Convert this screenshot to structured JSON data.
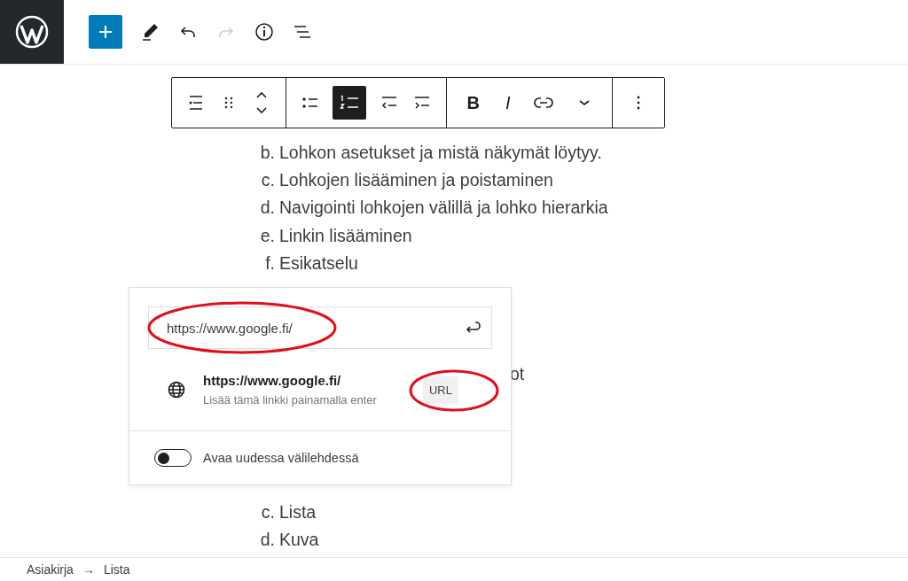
{
  "top_toolbar": {
    "add_block_selected": true,
    "redo_disabled": true
  },
  "block_toolbar": {
    "bulleted_selected": false,
    "numbered_selected": true,
    "bold": "B",
    "italic": "I"
  },
  "list_top": [
    {
      "marker": "b.",
      "text": "Lohkon asetukset ja mistä näkymät löytyy."
    },
    {
      "marker": "c.",
      "text": "Lohkojen lisääminen ja poistaminen"
    },
    {
      "marker": "d.",
      "text": "Navigointi lohkojen välillä ja lohko hierarkia"
    },
    {
      "marker": "e.",
      "text": "Linkin lisääminen"
    },
    {
      "marker": "f.",
      "text": "Esikatselu"
    }
  ],
  "covered_fragment": "ot",
  "list_bottom": [
    {
      "marker": "c.",
      "text": "Lista"
    },
    {
      "marker": "d.",
      "text": "Kuva"
    }
  ],
  "link_popover": {
    "url_value": "https://www.google.fi/",
    "url_circled": true,
    "suggestion": {
      "title": "https://www.google.fi/",
      "hint": "Lisää tämä linkki painamalla enter",
      "badge": "URL",
      "badge_circled": true
    },
    "new_tab": {
      "label": "Avaa uudessa välilehdessä",
      "on": false
    }
  },
  "breadcrumb": [
    "Asiakirja",
    "Lista"
  ],
  "breadcrumb_separator": "→"
}
